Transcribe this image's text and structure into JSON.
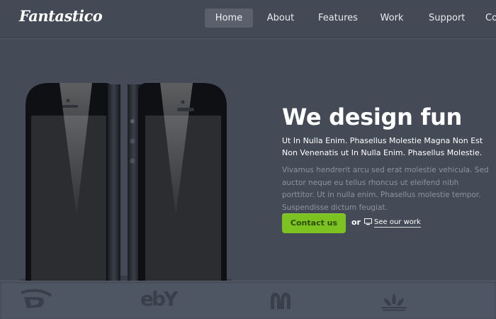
{
  "header": {
    "logo": "Fantastico",
    "nav": [
      {
        "label": "Home",
        "active": true
      },
      {
        "label": "About",
        "active": false
      },
      {
        "label": "Features",
        "active": false
      },
      {
        "label": "Work",
        "active": false
      },
      {
        "label": "Support",
        "active": false
      },
      {
        "label": "Co",
        "active": false
      }
    ]
  },
  "hero": {
    "title": "We design fun",
    "subtitle": "Ut In Nulla Enim. Phasellus Molestie Magna Non Est Non Venenatis ut In Nulla Enim. Phasellus Molestie.",
    "description": "Vivamus hendrerit arcu sed erat molestie vehicula. Sed auctor neque eu tellus rhoncus ut eleifend nibh porttitor. Ut in nulla enim. Phasellus molestie tempor. Suspendisse dictum feugiat.",
    "cta_label": "Contact us",
    "or_label": "or",
    "work_link_label": "See our work",
    "work_link_icon": "monitor-icon"
  },
  "brands": [
    {
      "name": "dreamworks-logo",
      "text": "D"
    },
    {
      "name": "ebay-logo",
      "text": "ebY"
    },
    {
      "name": "mcdonalds-logo",
      "text": "M"
    },
    {
      "name": "adidas-logo",
      "text": ""
    }
  ],
  "colors": {
    "background": "#444b57",
    "accent_green": "#7cc220",
    "muted_text": "#8c93a0"
  }
}
